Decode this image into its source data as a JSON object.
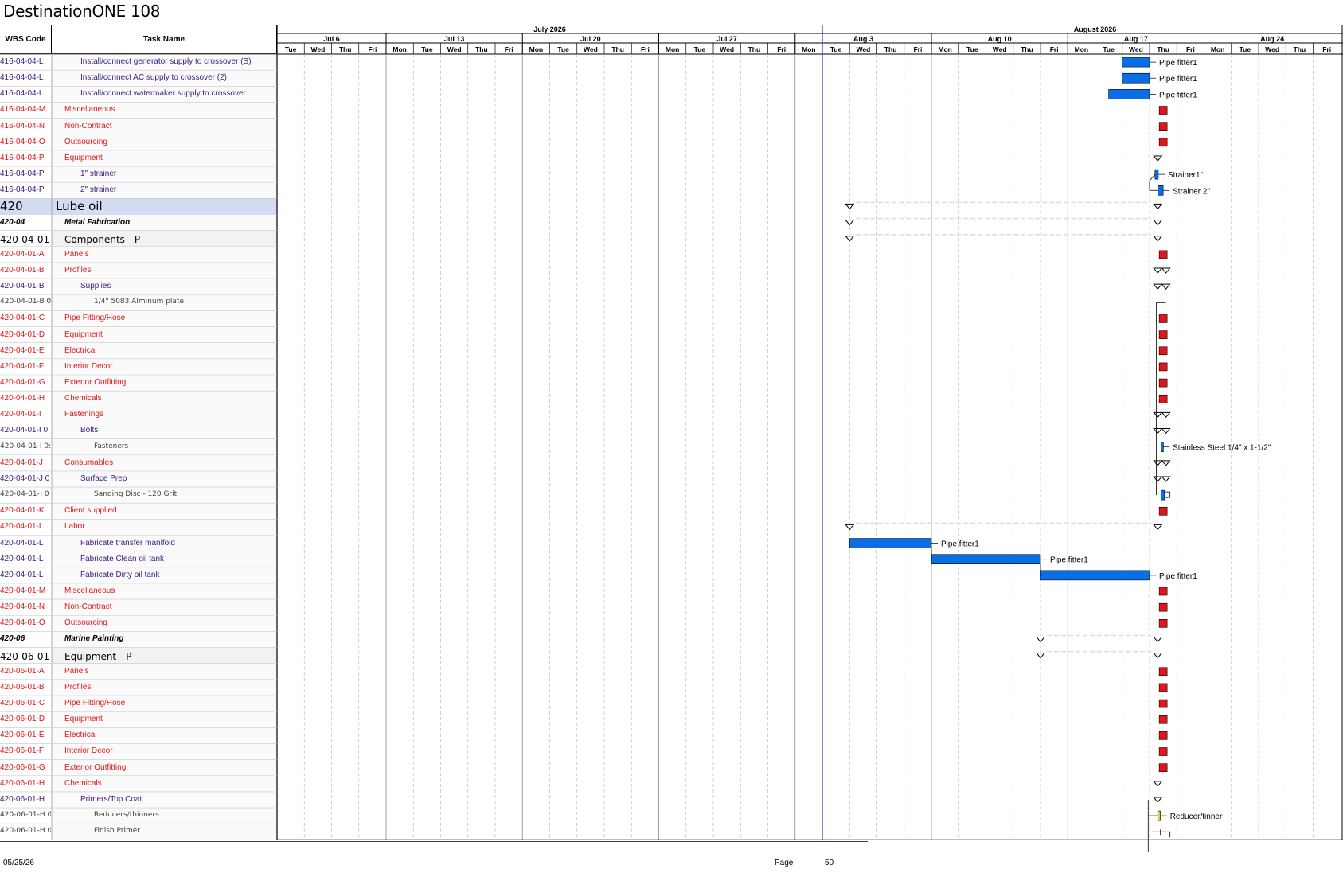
{
  "title": "DestinationONE 108",
  "columns": {
    "wbs": "WBS Code",
    "task": "Task Name"
  },
  "months": [
    {
      "label": "July 2026",
      "start": 0,
      "span": 20
    },
    {
      "label": "August 2026",
      "start": 20,
      "span": 20
    }
  ],
  "weeks": [
    "Jul 6",
    "Jul 13",
    "Jul 20",
    "Jul 27",
    "Aug 3",
    "Aug 10",
    "Aug 17",
    "Aug 24"
  ],
  "days": [
    "Tue",
    "Wed",
    "Thu",
    "Fri",
    "Mon",
    "Tue",
    "Wed",
    "Thu",
    "Fri",
    "Mon",
    "Tue",
    "Wed",
    "Thu",
    "Fri",
    "Mon",
    "Tue",
    "Wed",
    "Thu",
    "Fri",
    "Mon",
    "Tue",
    "Wed",
    "Thu",
    "Fri",
    "Mon",
    "Tue",
    "Wed",
    "Thu",
    "Fri",
    "Mon",
    "Tue",
    "Wed",
    "Thu",
    "Fri",
    "Mon",
    "Tue",
    "Wed",
    "Thu",
    "Fri"
  ],
  "colors": {
    "red": "#e0161b",
    "blue": "#0a6ee6",
    "purple": "#3a1a80",
    "gray": "#404040",
    "summary": "#d3dcf2",
    "today": "#3347b5"
  },
  "rows": [
    {
      "wbs": "416-04-04-L",
      "task": "Install/connect generator supply to crossover (S)",
      "color": "purple",
      "indent": 2,
      "bar": [
        31,
        32
      ],
      "label": "Pipe fitter1"
    },
    {
      "wbs": "416-04-04-L",
      "task": "Install/connect AC supply to crossover (2)",
      "color": "purple",
      "indent": 2,
      "bar": [
        31,
        32
      ],
      "label": "Pipe fitter1"
    },
    {
      "wbs": "416-04-04-L",
      "task": "Install/connect watermaker supply to crossover",
      "color": "purple",
      "indent": 2,
      "bar": [
        30.5,
        32
      ],
      "label": "Pipe fitter1"
    },
    {
      "wbs": "416-04-04-M",
      "task": "Miscellaneous",
      "color": "red",
      "indent": 1,
      "ms": 32.5
    },
    {
      "wbs": "416-04-04-N",
      "task": "Non-Contract",
      "color": "red",
      "indent": 1,
      "ms": 32.5
    },
    {
      "wbs": "416-04-04-O",
      "task": "Outsourcing",
      "color": "red",
      "indent": 1,
      "ms": 32.5
    },
    {
      "wbs": "416-04-04-P",
      "task": "Equipment",
      "color": "red",
      "indent": 1,
      "tri": [
        32.3
      ]
    },
    {
      "wbs": "416-04-04-P",
      "task": "1\" strainer",
      "color": "purple",
      "indent": 2,
      "bar": [
        32.2,
        32.32
      ],
      "label": "Strainer1\""
    },
    {
      "wbs": "416-04-04-P",
      "task": "2\" strainer",
      "color": "purple",
      "indent": 2,
      "bar": [
        32.3,
        32.5
      ],
      "label": "Strainer 2\""
    },
    {
      "wbs": "420",
      "task": "Lube oil",
      "color": "black",
      "indent": 0,
      "type": "big",
      "summary": true,
      "tri": [
        21,
        32.3
      ]
    },
    {
      "wbs": "420-04",
      "task": "Metal Fabrication",
      "color": "black",
      "indent": 0.5,
      "type": "bi",
      "tri": [
        21,
        32.3
      ]
    },
    {
      "wbs": "420-04-01",
      "task": "Components - P",
      "color": "black",
      "indent": 1,
      "type": "mid",
      "shade": true,
      "tri": [
        21,
        32.3
      ]
    },
    {
      "wbs": "420-04-01-A",
      "task": "Panels",
      "color": "red",
      "indent": 1,
      "ms": 32.5
    },
    {
      "wbs": "420-04-01-B",
      "task": "Profiles",
      "color": "red",
      "indent": 1,
      "tri": [
        32.3,
        32.6
      ]
    },
    {
      "wbs": "420-04-01-B",
      "task": "Supplies",
      "color": "purple",
      "indent": 2,
      "tri": [
        32.3,
        32.6
      ]
    },
    {
      "wbs": "420-04-01-B 0",
      "task": "1/4\" 5083 Alminum plate",
      "color": "gray",
      "indent": 3,
      "type": "small"
    },
    {
      "wbs": "420-04-01-C",
      "task": "Pipe Fitting/Hose",
      "color": "red",
      "indent": 1,
      "ms": 32.5
    },
    {
      "wbs": "420-04-01-D",
      "task": "Equipment",
      "color": "red",
      "indent": 1,
      "ms": 32.5
    },
    {
      "wbs": "420-04-01-E",
      "task": "Electrical",
      "color": "red",
      "indent": 1,
      "ms": 32.5
    },
    {
      "wbs": "420-04-01-F",
      "task": "Interior Decor",
      "color": "red",
      "indent": 1,
      "ms": 32.5
    },
    {
      "wbs": "420-04-01-G",
      "task": "Exterior Outfitting",
      "color": "red",
      "indent": 1,
      "ms": 32.5
    },
    {
      "wbs": "420-04-01-H",
      "task": "Chemicals",
      "color": "red",
      "indent": 1,
      "ms": 32.5
    },
    {
      "wbs": "420-04-01-I",
      "task": "Fastenings",
      "color": "red",
      "indent": 1,
      "tri": [
        32.3,
        32.6
      ]
    },
    {
      "wbs": "420-04-01-I 0",
      "task": "Bolts",
      "color": "purple",
      "indent": 2,
      "tri": [
        32.3,
        32.6
      ]
    },
    {
      "wbs": "420-04-01-I 0:",
      "task": "Fasteners",
      "color": "gray",
      "indent": 3,
      "type": "small",
      "bar": [
        32.42,
        32.5
      ],
      "label": "Stainless Steel 1/4\" x 1-1/2\""
    },
    {
      "wbs": "420-04-01-J",
      "task": "Consumables",
      "color": "red",
      "indent": 1,
      "tri": [
        32.3,
        32.6
      ]
    },
    {
      "wbs": "420-04-01-J 0",
      "task": "Surface Prep",
      "color": "purple",
      "indent": 2,
      "tri": [
        32.3,
        32.6
      ]
    },
    {
      "wbs": "420-04-01-J 0",
      "task": "Sanding Disc - 120 Grit",
      "color": "gray",
      "indent": 3,
      "type": "small",
      "bar": [
        32.42,
        32.55
      ]
    },
    {
      "wbs": "420-04-01-K",
      "task": "Client supplied",
      "color": "red",
      "indent": 1,
      "ms": 32.5
    },
    {
      "wbs": "420-04-01-L",
      "task": "Labor",
      "color": "red",
      "indent": 1,
      "tri": [
        21,
        32.3
      ]
    },
    {
      "wbs": "420-04-01-L",
      "task": "Fabricate transfer manifold",
      "color": "purple",
      "indent": 2,
      "bar": [
        21,
        24
      ],
      "label": "Pipe fitter1"
    },
    {
      "wbs": "420-04-01-L",
      "task": "Fabricate Clean oil tank",
      "color": "purple",
      "indent": 2,
      "bar": [
        24,
        28
      ],
      "label": "Pipe fitter1"
    },
    {
      "wbs": "420-04-01-L",
      "task": "Fabricate Dirty oil tank",
      "color": "purple",
      "indent": 2,
      "bar": [
        28,
        32
      ],
      "label": "Pipe fitter1"
    },
    {
      "wbs": "420-04-01-M",
      "task": "Miscellaneous",
      "color": "red",
      "indent": 1,
      "ms": 32.5
    },
    {
      "wbs": "420-04-01-N",
      "task": "Non-Contract",
      "color": "red",
      "indent": 1,
      "ms": 32.5
    },
    {
      "wbs": "420-04-01-O",
      "task": "Outsourcing",
      "color": "red",
      "indent": 1,
      "ms": 32.5
    },
    {
      "wbs": "420-06",
      "task": "Marine Painting",
      "color": "black",
      "indent": 0.5,
      "type": "bi",
      "tri": [
        28,
        32.3
      ]
    },
    {
      "wbs": "420-06-01",
      "task": "Equipment - P",
      "color": "black",
      "indent": 1,
      "type": "mid",
      "shade": true,
      "tri": [
        28,
        32.3
      ]
    },
    {
      "wbs": "420-06-01-A",
      "task": "Panels",
      "color": "red",
      "indent": 1,
      "ms": 32.5
    },
    {
      "wbs": "420-06-01-B",
      "task": "Profiles",
      "color": "red",
      "indent": 1,
      "ms": 32.5
    },
    {
      "wbs": "420-06-01-C",
      "task": "Pipe Fitting/Hose",
      "color": "red",
      "indent": 1,
      "ms": 32.5
    },
    {
      "wbs": "420-06-01-D",
      "task": "Equipment",
      "color": "red",
      "indent": 1,
      "ms": 32.5
    },
    {
      "wbs": "420-06-01-E",
      "task": "Electrical",
      "color": "red",
      "indent": 1,
      "ms": 32.5
    },
    {
      "wbs": "420-06-01-F",
      "task": "Interior Decor",
      "color": "red",
      "indent": 1,
      "ms": 32.5
    },
    {
      "wbs": "420-06-01-G",
      "task": "Exterior Outfitting",
      "color": "red",
      "indent": 1,
      "ms": 32.5
    },
    {
      "wbs": "420-06-01-H",
      "task": "Chemicals",
      "color": "red",
      "indent": 1,
      "tri": [
        32.3
      ]
    },
    {
      "wbs": "420-06-01-H",
      "task": "Primers/Top Coat",
      "color": "purple",
      "indent": 2,
      "tri": [
        32.3
      ]
    },
    {
      "wbs": "420-06-01-H 0",
      "task": "Reducers/thinners",
      "color": "gray",
      "indent": 3,
      "type": "small",
      "bar": [
        32.3,
        32.4
      ],
      "barColor": "#e8c840",
      "label": "Reducer/tinner"
    },
    {
      "wbs": "420-06-01-H 0",
      "task": "Finish Primer",
      "color": "gray",
      "indent": 3,
      "type": "small"
    }
  ],
  "footer": {
    "date": "05/25/26",
    "page_label": "Page",
    "page_number": "50"
  }
}
